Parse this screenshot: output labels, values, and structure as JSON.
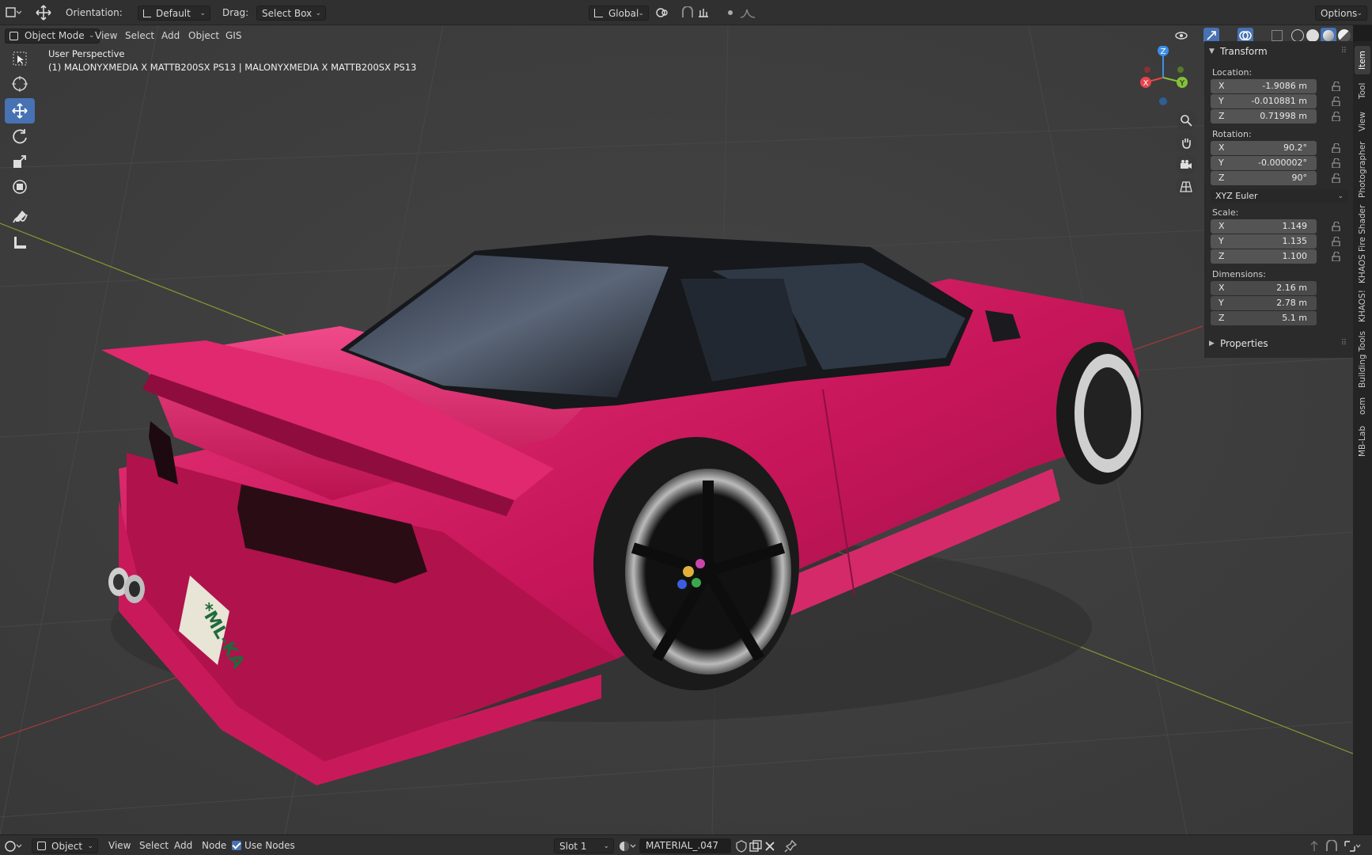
{
  "header": {
    "orientation_label": "Orientation:",
    "orientation_value": "Default",
    "drag_label": "Drag:",
    "drag_value": "Select Box",
    "transform_orientation": "Global",
    "options_label": "Options"
  },
  "viewport_menu": {
    "mode": "Object Mode",
    "items": [
      "View",
      "Select",
      "Add",
      "Object",
      "GIS"
    ]
  },
  "viewport_info": {
    "perspective": "User Perspective",
    "object": "(1) MALONYXMEDIA X MATTB200SX PS13 | MALONYXMEDIA X MATTB200SX PS13"
  },
  "gizmo": {
    "x": "X",
    "y": "Y",
    "z": "Z"
  },
  "scene": {
    "plate_text": "*ML-KA"
  },
  "npanel": {
    "transform_title": "Transform",
    "location_label": "Location:",
    "location": [
      {
        "axis": "X",
        "value": "-1.9086 m"
      },
      {
        "axis": "Y",
        "value": "-0.010881 m"
      },
      {
        "axis": "Z",
        "value": "0.71998 m"
      }
    ],
    "rotation_label": "Rotation:",
    "rotation": [
      {
        "axis": "X",
        "value": "90.2°"
      },
      {
        "axis": "Y",
        "value": "-0.000002°"
      },
      {
        "axis": "Z",
        "value": "90°"
      }
    ],
    "rotation_mode": "XYZ Euler",
    "scale_label": "Scale:",
    "scale": [
      {
        "axis": "X",
        "value": "1.149"
      },
      {
        "axis": "Y",
        "value": "1.135"
      },
      {
        "axis": "Z",
        "value": "1.100"
      }
    ],
    "dimensions_label": "Dimensions:",
    "dimensions": [
      {
        "axis": "X",
        "value": "2.16 m"
      },
      {
        "axis": "Y",
        "value": "2.78 m"
      },
      {
        "axis": "Z",
        "value": "5.1 m"
      }
    ],
    "properties_title": "Properties"
  },
  "sidetabs": [
    "Item",
    "Tool",
    "View",
    "Photographer",
    "KHAOS Fire Shader",
    "KHAOS!",
    "Building Tools",
    "osm",
    "MB-Lab"
  ],
  "bottombar": {
    "editor": "Object",
    "menu": [
      "View",
      "Select",
      "Add",
      "Node"
    ],
    "use_nodes": "Use Nodes",
    "slot": "Slot 1",
    "material": "MATERIAL_.047"
  },
  "colors": {
    "accent": "#4772b3",
    "car_paint": "#d81e62",
    "axis_x": "#e8444a",
    "axis_y": "#84c13a",
    "axis_z": "#3b8ee7"
  }
}
